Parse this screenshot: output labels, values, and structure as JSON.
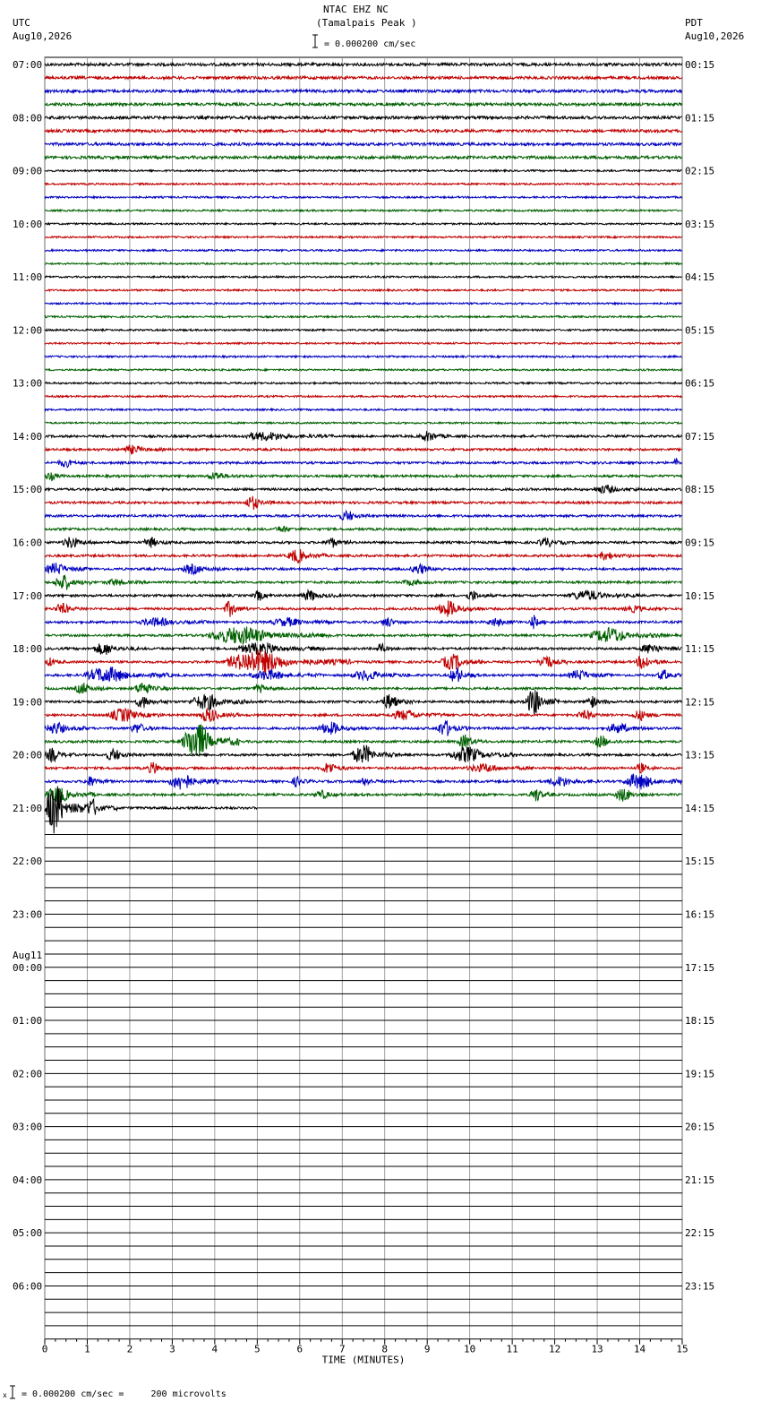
{
  "header": {
    "title_line1": "NTAC EHZ NC",
    "title_line2": "(Tamalpais Peak )",
    "scale_text": "= 0.000200 cm/sec",
    "left_tz": "UTC",
    "left_date": "Aug10,2026",
    "right_tz": "PDT",
    "right_date": "Aug10,2026"
  },
  "footer": {
    "scale_text": "= 0.000200 cm/sec =     200 microvolts"
  },
  "chart_data": {
    "type": "line",
    "xlabel": "TIME (MINUTES)",
    "xlim": [
      0,
      15
    ],
    "x_ticks": [
      "0",
      "1",
      "2",
      "3",
      "4",
      "5",
      "6",
      "7",
      "8",
      "9",
      "10",
      "11",
      "12",
      "13",
      "14",
      "15"
    ],
    "rows_per_hour": 4,
    "total_rows": 96,
    "trace_colors": [
      "#000000",
      "#c00000",
      "#0000c0",
      "#006000"
    ],
    "grid": true,
    "left_labels": [
      {
        "row": 0,
        "text": "07:00"
      },
      {
        "row": 4,
        "text": "08:00"
      },
      {
        "row": 8,
        "text": "09:00"
      },
      {
        "row": 12,
        "text": "10:00"
      },
      {
        "row": 16,
        "text": "11:00"
      },
      {
        "row": 20,
        "text": "12:00"
      },
      {
        "row": 24,
        "text": "13:00"
      },
      {
        "row": 28,
        "text": "14:00"
      },
      {
        "row": 32,
        "text": "15:00"
      },
      {
        "row": 36,
        "text": "16:00"
      },
      {
        "row": 40,
        "text": "17:00"
      },
      {
        "row": 44,
        "text": "18:00"
      },
      {
        "row": 48,
        "text": "19:00"
      },
      {
        "row": 52,
        "text": "20:00"
      },
      {
        "row": 56,
        "text": "21:00"
      },
      {
        "row": 60,
        "text": "22:00"
      },
      {
        "row": 64,
        "text": "23:00"
      },
      {
        "row": 68,
        "text": "00:00",
        "date": "Aug11"
      },
      {
        "row": 72,
        "text": "01:00"
      },
      {
        "row": 76,
        "text": "02:00"
      },
      {
        "row": 80,
        "text": "03:00"
      },
      {
        "row": 84,
        "text": "04:00"
      },
      {
        "row": 88,
        "text": "05:00"
      },
      {
        "row": 92,
        "text": "06:00"
      }
    ],
    "right_labels": [
      {
        "row": 0,
        "text": "00:15"
      },
      {
        "row": 4,
        "text": "01:15"
      },
      {
        "row": 8,
        "text": "02:15"
      },
      {
        "row": 12,
        "text": "03:15"
      },
      {
        "row": 16,
        "text": "04:15"
      },
      {
        "row": 20,
        "text": "05:15"
      },
      {
        "row": 24,
        "text": "06:15"
      },
      {
        "row": 28,
        "text": "07:15"
      },
      {
        "row": 32,
        "text": "08:15"
      },
      {
        "row": 36,
        "text": "09:15"
      },
      {
        "row": 40,
        "text": "10:15"
      },
      {
        "row": 44,
        "text": "11:15"
      },
      {
        "row": 48,
        "text": "12:15"
      },
      {
        "row": 52,
        "text": "13:15"
      },
      {
        "row": 56,
        "text": "14:15"
      },
      {
        "row": 60,
        "text": "15:15"
      },
      {
        "row": 64,
        "text": "16:15"
      },
      {
        "row": 68,
        "text": "17:15"
      },
      {
        "row": 72,
        "text": "18:15"
      },
      {
        "row": 76,
        "text": "19:15"
      },
      {
        "row": 80,
        "text": "20:15"
      },
      {
        "row": 84,
        "text": "21:15"
      },
      {
        "row": 88,
        "text": "22:15"
      },
      {
        "row": 92,
        "text": "23:15"
      }
    ],
    "data_rows_full": 56,
    "last_row_end_minute": 5,
    "events": [
      {
        "row": 28,
        "start": 4.6,
        "end": 6.8,
        "amp": 4
      },
      {
        "row": 28,
        "start": 8.8,
        "end": 9.6,
        "amp": 5
      },
      {
        "row": 29,
        "start": 1.8,
        "end": 2.8,
        "amp": 4
      },
      {
        "row": 30,
        "start": 0.3,
        "end": 1.0,
        "amp": 4
      },
      {
        "row": 30,
        "start": 14.8,
        "end": 15.0,
        "amp": 5
      },
      {
        "row": 31,
        "start": 0.0,
        "end": 0.5,
        "amp": 4
      },
      {
        "row": 31,
        "start": 3.8,
        "end": 4.7,
        "amp": 4
      },
      {
        "row": 32,
        "start": 12.9,
        "end": 14.0,
        "amp": 4
      },
      {
        "row": 33,
        "start": 4.7,
        "end": 5.4,
        "amp": 7
      },
      {
        "row": 34,
        "start": 6.9,
        "end": 7.7,
        "amp": 5
      },
      {
        "row": 35,
        "start": 5.4,
        "end": 6.1,
        "amp": 3
      },
      {
        "row": 36,
        "start": 0.4,
        "end": 1.2,
        "amp": 6
      },
      {
        "row": 36,
        "start": 2.3,
        "end": 3.0,
        "amp": 5
      },
      {
        "row": 36,
        "start": 6.6,
        "end": 7.2,
        "amp": 5
      },
      {
        "row": 36,
        "start": 11.6,
        "end": 12.3,
        "amp": 5
      },
      {
        "row": 37,
        "start": 5.7,
        "end": 6.6,
        "amp": 7
      },
      {
        "row": 37,
        "start": 13.0,
        "end": 13.8,
        "amp": 4
      },
      {
        "row": 38,
        "start": 0.0,
        "end": 1.0,
        "amp": 6
      },
      {
        "row": 38,
        "start": 3.2,
        "end": 4.2,
        "amp": 5
      },
      {
        "row": 38,
        "start": 8.6,
        "end": 9.4,
        "amp": 5
      },
      {
        "row": 39,
        "start": 0.2,
        "end": 1.1,
        "amp": 8
      },
      {
        "row": 39,
        "start": 1.4,
        "end": 2.4,
        "amp": 3
      },
      {
        "row": 39,
        "start": 8.4,
        "end": 9.2,
        "amp": 3
      },
      {
        "row": 40,
        "start": 4.9,
        "end": 5.4,
        "amp": 5
      },
      {
        "row": 40,
        "start": 6.0,
        "end": 6.9,
        "amp": 5
      },
      {
        "row": 40,
        "start": 9.9,
        "end": 10.5,
        "amp": 5
      },
      {
        "row": 40,
        "start": 12.3,
        "end": 14.0,
        "amp": 5
      },
      {
        "row": 41,
        "start": 0.2,
        "end": 1.0,
        "amp": 5
      },
      {
        "row": 41,
        "start": 4.2,
        "end": 4.8,
        "amp": 8
      },
      {
        "row": 41,
        "start": 9.2,
        "end": 10.3,
        "amp": 8
      },
      {
        "row": 41,
        "start": 13.6,
        "end": 14.6,
        "amp": 3
      },
      {
        "row": 42,
        "start": 2.2,
        "end": 3.8,
        "amp": 4
      },
      {
        "row": 42,
        "start": 5.3,
        "end": 6.8,
        "amp": 4
      },
      {
        "row": 42,
        "start": 7.9,
        "end": 8.5,
        "amp": 5
      },
      {
        "row": 42,
        "start": 10.4,
        "end": 11.2,
        "amp": 4
      },
      {
        "row": 42,
        "start": 11.4,
        "end": 11.8,
        "amp": 7
      },
      {
        "row": 43,
        "start": 3.8,
        "end": 6.8,
        "amp": 9
      },
      {
        "row": 43,
        "start": 12.8,
        "end": 14.6,
        "amp": 8
      },
      {
        "row": 44,
        "start": 1.1,
        "end": 2.2,
        "amp": 6
      },
      {
        "row": 44,
        "start": 4.5,
        "end": 6.6,
        "amp": 6
      },
      {
        "row": 44,
        "start": 7.8,
        "end": 8.2,
        "amp": 6
      },
      {
        "row": 44,
        "start": 14.0,
        "end": 15.0,
        "amp": 5
      },
      {
        "row": 45,
        "start": 0.0,
        "end": 0.5,
        "amp": 4
      },
      {
        "row": 45,
        "start": 4.2,
        "end": 7.2,
        "amp": 12
      },
      {
        "row": 45,
        "start": 9.3,
        "end": 10.4,
        "amp": 8
      },
      {
        "row": 45,
        "start": 11.6,
        "end": 12.3,
        "amp": 8
      },
      {
        "row": 45,
        "start": 13.9,
        "end": 14.6,
        "amp": 8
      },
      {
        "row": 46,
        "start": 0.9,
        "end": 3.0,
        "amp": 8
      },
      {
        "row": 46,
        "start": 4.8,
        "end": 6.5,
        "amp": 5
      },
      {
        "row": 46,
        "start": 7.2,
        "end": 8.6,
        "amp": 5
      },
      {
        "row": 46,
        "start": 9.5,
        "end": 10.2,
        "amp": 8
      },
      {
        "row": 46,
        "start": 12.3,
        "end": 13.3,
        "amp": 5
      },
      {
        "row": 46,
        "start": 14.4,
        "end": 15.0,
        "amp": 5
      },
      {
        "row": 47,
        "start": 0.7,
        "end": 1.4,
        "amp": 6
      },
      {
        "row": 47,
        "start": 2.1,
        "end": 2.9,
        "amp": 7
      },
      {
        "row": 47,
        "start": 4.9,
        "end": 5.5,
        "amp": 4
      },
      {
        "row": 48,
        "start": 2.1,
        "end": 2.9,
        "amp": 6
      },
      {
        "row": 48,
        "start": 3.4,
        "end": 4.9,
        "amp": 8
      },
      {
        "row": 48,
        "start": 7.9,
        "end": 8.7,
        "amp": 8
      },
      {
        "row": 48,
        "start": 11.3,
        "end": 12.1,
        "amp": 14
      },
      {
        "row": 48,
        "start": 12.7,
        "end": 13.3,
        "amp": 6
      },
      {
        "row": 49,
        "start": 1.5,
        "end": 2.8,
        "amp": 7
      },
      {
        "row": 49,
        "start": 3.6,
        "end": 4.6,
        "amp": 7
      },
      {
        "row": 49,
        "start": 8.1,
        "end": 9.5,
        "amp": 5
      },
      {
        "row": 49,
        "start": 12.5,
        "end": 13.4,
        "amp": 4
      },
      {
        "row": 49,
        "start": 13.8,
        "end": 14.6,
        "amp": 5
      },
      {
        "row": 50,
        "start": 0.0,
        "end": 1.0,
        "amp": 6
      },
      {
        "row": 50,
        "start": 2.0,
        "end": 2.7,
        "amp": 5
      },
      {
        "row": 50,
        "start": 6.4,
        "end": 7.6,
        "amp": 6
      },
      {
        "row": 50,
        "start": 9.2,
        "end": 10.0,
        "amp": 8
      },
      {
        "row": 50,
        "start": 13.2,
        "end": 14.3,
        "amp": 5
      },
      {
        "row": 51,
        "start": 3.2,
        "end": 4.6,
        "amp": 20
      },
      {
        "row": 51,
        "start": 9.7,
        "end": 10.4,
        "amp": 7
      },
      {
        "row": 51,
        "start": 12.9,
        "end": 13.6,
        "amp": 6
      },
      {
        "row": 52,
        "start": 0.0,
        "end": 0.7,
        "amp": 7
      },
      {
        "row": 52,
        "start": 1.4,
        "end": 2.2,
        "amp": 6
      },
      {
        "row": 52,
        "start": 7.2,
        "end": 8.3,
        "amp": 10
      },
      {
        "row": 52,
        "start": 9.5,
        "end": 11.1,
        "amp": 8
      },
      {
        "row": 53,
        "start": 2.4,
        "end": 3.0,
        "amp": 6
      },
      {
        "row": 53,
        "start": 6.5,
        "end": 7.2,
        "amp": 6
      },
      {
        "row": 53,
        "start": 9.9,
        "end": 11.5,
        "amp": 4
      },
      {
        "row": 53,
        "start": 13.9,
        "end": 14.4,
        "amp": 5
      },
      {
        "row": 54,
        "start": 0.9,
        "end": 1.6,
        "amp": 5
      },
      {
        "row": 54,
        "start": 2.9,
        "end": 4.1,
        "amp": 9
      },
      {
        "row": 54,
        "start": 5.8,
        "end": 6.3,
        "amp": 5
      },
      {
        "row": 54,
        "start": 7.4,
        "end": 8.0,
        "amp": 4
      },
      {
        "row": 54,
        "start": 11.8,
        "end": 13.0,
        "amp": 5
      },
      {
        "row": 54,
        "start": 13.6,
        "end": 15.0,
        "amp": 8
      },
      {
        "row": 55,
        "start": 0.0,
        "end": 1.2,
        "amp": 8
      },
      {
        "row": 55,
        "start": 6.3,
        "end": 7.1,
        "amp": 4
      },
      {
        "row": 55,
        "start": 11.4,
        "end": 12.0,
        "amp": 7
      },
      {
        "row": 55,
        "start": 13.4,
        "end": 14.2,
        "amp": 7
      },
      {
        "row": 56,
        "start": 0.0,
        "end": 0.9,
        "amp": 28
      },
      {
        "row": 56,
        "start": 0.9,
        "end": 1.7,
        "amp": 9
      }
    ]
  }
}
